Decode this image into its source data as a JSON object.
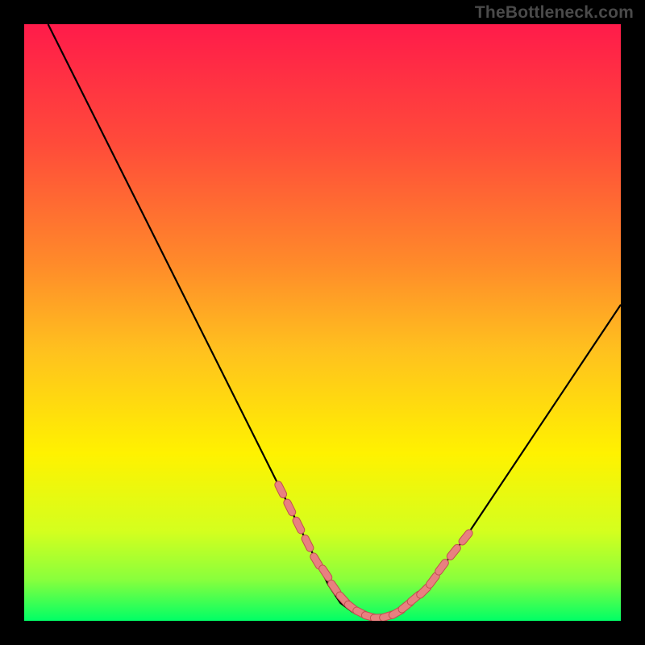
{
  "watermark": "TheBottleneck.com",
  "colors": {
    "frame": "#000000",
    "gradient_stops": [
      {
        "offset": 0.0,
        "color": "#ff1b4a"
      },
      {
        "offset": 0.2,
        "color": "#ff4b3a"
      },
      {
        "offset": 0.4,
        "color": "#ff8a2a"
      },
      {
        "offset": 0.55,
        "color": "#ffc21e"
      },
      {
        "offset": 0.72,
        "color": "#fff200"
      },
      {
        "offset": 0.85,
        "color": "#d4ff1e"
      },
      {
        "offset": 0.93,
        "color": "#8aff3c"
      },
      {
        "offset": 1.0,
        "color": "#00ff66"
      }
    ],
    "curve": "#000000",
    "markers_fill": "#e88080",
    "markers_stroke": "#c05050"
  },
  "chart_data": {
    "type": "line",
    "title": "",
    "xlabel": "",
    "ylabel": "",
    "xlim": [
      0,
      100
    ],
    "ylim": [
      0,
      100
    ],
    "series": [
      {
        "name": "curve",
        "x": [
          4,
          8,
          12,
          16,
          20,
          24,
          28,
          32,
          36,
          40,
          43,
          46,
          49,
          51,
          53,
          55,
          57,
          58,
          60,
          62,
          64,
          67,
          70,
          74,
          78,
          82,
          86,
          90,
          94,
          98,
          100
        ],
        "y": [
          100,
          92,
          84,
          76,
          68,
          60,
          52,
          44,
          36,
          28,
          22,
          16,
          10,
          6,
          3,
          1.5,
          0.8,
          0.5,
          0.6,
          1.2,
          2.5,
          5,
          9,
          14,
          20,
          26,
          32,
          38,
          44,
          50,
          53
        ]
      }
    ],
    "highlight_points": {
      "name": "markers",
      "x": [
        43,
        44.5,
        46,
        47.5,
        49,
        50.5,
        52,
        53.5,
        55,
        56.5,
        58,
        59.5,
        61,
        62.5,
        64,
        65.5,
        67,
        68.5,
        70,
        72,
        74
      ],
      "y": [
        22,
        19,
        16,
        13,
        10,
        8,
        5.5,
        3.6,
        2.2,
        1.3,
        0.7,
        0.5,
        0.8,
        1.4,
        2.5,
        3.8,
        5,
        6.8,
        9,
        11.5,
        14
      ]
    }
  }
}
